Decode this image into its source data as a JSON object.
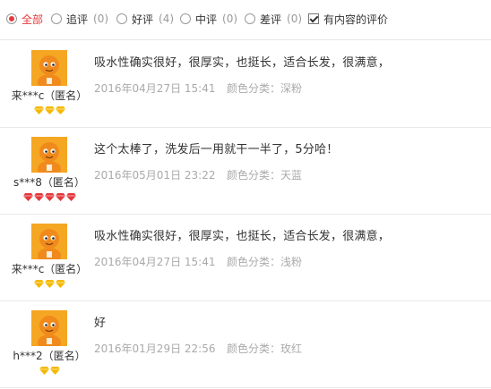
{
  "filters": [
    {
      "label": "全部",
      "count": "",
      "checked": true
    },
    {
      "label": "追评",
      "count": "(0)",
      "checked": false
    },
    {
      "label": "好评",
      "count": "(4)",
      "checked": false
    },
    {
      "label": "中评",
      "count": "(0)",
      "checked": false
    },
    {
      "label": "差评",
      "count": "(0)",
      "checked": false
    }
  ],
  "content_only": {
    "label": "有内容的评价",
    "checked": true
  },
  "reviews": [
    {
      "user": "来***c（匿名）",
      "badge_color": "#f5b800",
      "badge_count": 3,
      "comment": "吸水性确实很好，很厚实，也挺长，适合长发，很满意，",
      "datetime": "2016年04月27日 15:41",
      "color": "颜色分类：深粉"
    },
    {
      "user": "s***8（匿名）",
      "badge_color": "#e4393c",
      "badge_count": 5,
      "comment": "这个太棒了，洗发后一用就干一半了，5分哈！",
      "datetime": "2016年05月01日 23:22",
      "color": "颜色分类：天蓝"
    },
    {
      "user": "来***c（匿名）",
      "badge_color": "#f5b800",
      "badge_count": 3,
      "comment": "吸水性确实很好，很厚实，也挺长，适合长发，很满意，",
      "datetime": "2016年04月27日 15:41",
      "color": "颜色分类：浅粉"
    },
    {
      "user": "h***2（匿名）",
      "badge_color": "#f5b800",
      "badge_count": 2,
      "comment": "好",
      "datetime": "2016年01月29日 22:56",
      "color": "颜色分类：玫红"
    }
  ]
}
